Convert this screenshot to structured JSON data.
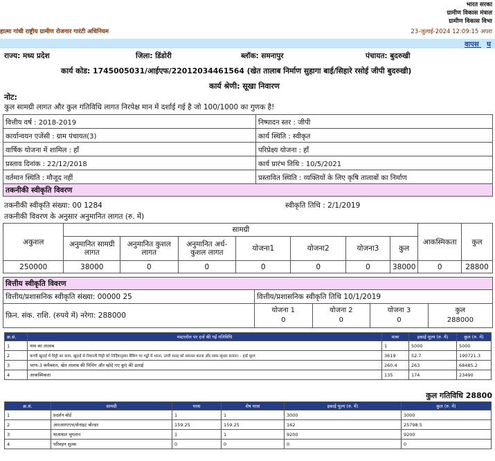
{
  "header": {
    "gov_lines": [
      "भारत सरका",
      "ग्रामीण विकास मंत्राल",
      "ग्रामीण विकास विभा"
    ],
    "scheme": "हात्मा गांधी राष्ट्रीय ग्रामीण रोजगार गारंटी अधिनियम",
    "datetime": "23-जुलाई-2024 12:09:15 अपरा",
    "back_link": "वापस",
    "back_extra": "घ"
  },
  "location": {
    "state": "राज्य: मध्य प्रदेश",
    "district": "जिला: डिंडोरी",
    "block": "ब्लॉक: समनापुर",
    "panchayat": "पंचायत: बुदरुखी"
  },
  "work": {
    "code": "कार्य कोड: 1745005031/आईएफ/22012034461564 (खेत तालाब निर्माण सुहागा बाई/सिहारे रसोई जीपी बुदरुखी)",
    "category": "कार्य श्रेणी: सूखा निवारण"
  },
  "note": {
    "title": "नोट:",
    "text": "कुल सामग्री लागत और कुल गतिविधि लागत निरपेक्ष मान में दर्शाई गई है जो 100/1000 का गुणक है!"
  },
  "details": [
    [
      "वित्तीय वर्ष : 2018-2019",
      "निष्पादन स्तर : जीपी"
    ],
    [
      "कार्यान्वयन एजेंसी : ग्राम पंचायत(3)",
      "कार्य स्थिति : स्वीकृत"
    ],
    [
      "वार्षिक योजना में शामिल : हाँ",
      "परिप्रेक्ष्य योजना : हाँ"
    ],
    [
      "प्रस्ताव दिनांक : 22/12/2018",
      "कार्य प्रारंभ तिथि : 10/5/2021"
    ],
    [
      "वर्तमान स्थिति : मौजूद नहीं",
      "प्रस्तावित स्थिति : व्यक्तियों के लिए कृषि तालाबों का निर्माण"
    ]
  ],
  "technical": {
    "header": "तकनीकी स्वीकृति विवरण",
    "number": "तकनीकी स्वीकृति संख्या: 00 1284",
    "date": "स्वीकृति तिथि : 2/1/2019",
    "est_label": "तकनीकी विवरण के अनुसार अनुमानित लागत (रु. में)"
  },
  "cost": {
    "material_group": "सामग्री",
    "h_unskilled": "अकुशल",
    "h_mat": "अनुमानित सामग्री लागत",
    "h_skilled": "अनुमानित कुशल लागत",
    "h_semi": "अनुमानित अर्ध-कुशल लागत",
    "h_y1": "योजना1",
    "h_y2": "योजना2",
    "h_y3": "योजना3",
    "h_total": "कुल",
    "h_cont": "आकस्मिकता",
    "h_grand": "कुल",
    "values": [
      "250000",
      "38000",
      "0",
      "0",
      "0",
      "0",
      "0",
      "38000",
      "0",
      "28800"
    ]
  },
  "financial": {
    "header": "वित्तीय स्वीकृति विवरण",
    "number": "वित्तीय/प्रशासनिक स्वीकृति संख्या: 00000 25",
    "date": "वित्तीय/प्रशासनिक स्वीकृति तिथि 10/1/2019",
    "amount": "फ़िन. संक. राशि. (रुपये में) नरेगा: 288000",
    "y1": "योजना 1",
    "y1v": "0",
    "y2": "योजना 2",
    "y2v": "0",
    "y3": "योजना 3",
    "y3v": "0",
    "total": "कुल",
    "totalv": "288000"
  },
  "activities": {
    "headers": [
      "क्र.सं.",
      "मस्टररोल पर दर्ज की गई गतिविधि",
      "मात्रा",
      "इकाई मूल्य (रु. में)",
      "कुल (रु. में)"
    ],
    "rows": [
      [
        "1",
        "नाम का तालाब",
        "1",
        "5000",
        "5000"
      ],
      [
        "2",
        "कच्ची खुदाई में मिट्टी का काम, खुदाई से निकाली मिट्टी को निर्दिष्टानुसार बैंकिंग पर गड्ढों में भरना, उपरी सतह को समतल करना और साफ-सुथरा बनाना। - हार्ड मूरम",
        "3619",
        "52.7",
        "190721.3"
      ],
      [
        "3",
        "चरण-3 कंपैक्शन, खेत तालाब की पिचिंग और खोदे गए कुएं की ढलाई",
        "260.4",
        "263",
        "68485.2"
      ],
      [
        "4",
        "आकस्मिकता",
        "135",
        "174",
        "23490"
      ]
    ],
    "total": "कुल गतिविधि 28800"
  },
  "materials": {
    "headers": [
      "क्र.सं.",
      "सामग्री",
      "मात्रा",
      "शेष मात्रा",
      "इकाई मूल्य (रु. में)",
      "कुल (रु. में)"
    ],
    "rows": [
      [
        "1",
        "प्रदर्शन बोर्ड",
        "1",
        "1",
        "3000",
        "3000"
      ],
      [
        "2",
        "आरआरएएच/सेनाइट बोल्डर",
        "159.25",
        "159.25",
        "162",
        "25798.5"
      ],
      [
        "3",
        "यातायात भुगतान",
        "1",
        "1",
        "9200",
        "9200"
      ],
      [
        "4",
        "परिवहन शुल्क",
        "0",
        "0",
        "0",
        "0"
      ]
    ]
  }
}
